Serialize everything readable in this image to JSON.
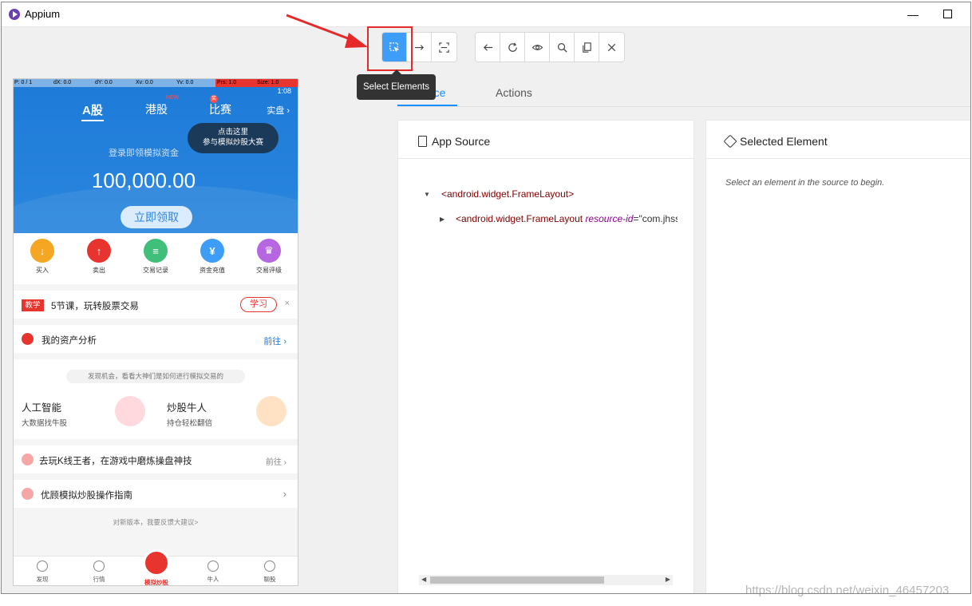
{
  "window": {
    "title": "Appium",
    "minimize": "—"
  },
  "toolbar": {
    "group1": [
      "select-elements",
      "swipe-by-coordinates",
      "tap-by-coordinates"
    ],
    "group2": [
      "back",
      "refresh",
      "show-hide-attributes",
      "search",
      "copy-xml",
      "quit-session"
    ],
    "tooltip": "Select Elements"
  },
  "phone": {
    "inspector": [
      "P: 0 / 1",
      "dX: 0.0",
      "dY: 0.0",
      "Xv: 0.0",
      "Yv: 0.0",
      "Prs: 1.0",
      "Size: 1.0"
    ],
    "time": "1:08",
    "tabs": [
      "A股",
      "港股",
      "比赛"
    ],
    "new_badge": "NEW",
    "dot_badge": "奖",
    "real_trade": "实盘 ›",
    "bubble": [
      "点击这里",
      "参与模拟炒股大赛"
    ],
    "subtitle": "登录即领模拟资金",
    "amount": "100,000.00",
    "claim_button": "立即领取",
    "icons": [
      {
        "label": "买入",
        "color": "#f5a623",
        "glyph": "↓"
      },
      {
        "label": "卖出",
        "color": "#e8342f",
        "glyph": "↑"
      },
      {
        "label": "交易记录",
        "color": "#3fbf7a",
        "glyph": "≡"
      },
      {
        "label": "资金充值",
        "color": "#3d9df7",
        "glyph": "¥"
      },
      {
        "label": "交易评级",
        "color": "#b566e0",
        "glyph": "♛"
      }
    ],
    "lesson": {
      "tag": "教学",
      "text": "5节课，玩转股票交易",
      "button": "学习",
      "close": "×"
    },
    "asset": {
      "text": "我的资产分析",
      "link": "前往 ›"
    },
    "discover": {
      "pill": "发现机会，看看大神们是如何进行模拟交易的",
      "left": {
        "title": "人工智能",
        "sub": "大数据找牛股"
      },
      "right": {
        "title": "炒股牛人",
        "sub": "持仓轻松翻倍"
      }
    },
    "game": {
      "text": "去玩K线王者，在游戏中磨炼操盘神技",
      "link": "前往 ›"
    },
    "guide": {
      "text": "优顾模拟炒股操作指南",
      "link": "›"
    },
    "feedback": "对新版本，我要反馈大建议>",
    "nav": [
      "发现",
      "行情",
      "模拟炒股",
      "牛人",
      "聊股"
    ]
  },
  "tabs": {
    "source": "Source",
    "actions": "Actions"
  },
  "source_panel": {
    "title": "App Source",
    "root": "<android.widget.FrameLayout>",
    "child_tag": "<android.widget.FrameLayout",
    "child_attr_name": "resource-id",
    "child_attr_eq": "=",
    "child_attr_val": "\"com.jhss"
  },
  "selected_panel": {
    "title": "Selected Element",
    "placeholder": "Select an element in the source to begin."
  },
  "watermark": "https://blog.csdn.net/weixin_46457203"
}
